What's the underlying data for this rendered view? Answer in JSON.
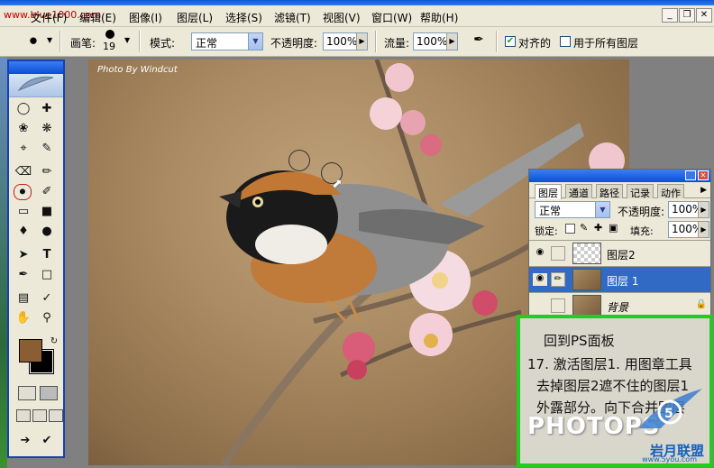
{
  "watermark_top": "www.blue1000.com",
  "menu": {
    "items": [
      "文件(F)",
      "编辑(E)",
      "图像(I)",
      "图层(L)",
      "选择(S)",
      "滤镜(T)",
      "视图(V)",
      "窗口(W)",
      "帮助(H)"
    ]
  },
  "window_controls": {
    "minimize": "_",
    "restore": "❐",
    "close": "✕"
  },
  "options": {
    "brush_label": "画笔:",
    "brush_size": "19",
    "mode_label": "模式:",
    "mode_value": "正常",
    "opacity_label": "不透明度:",
    "opacity_value": "100%",
    "flow_label": "流量:",
    "flow_value": "100%",
    "aligned_label": "对齐的",
    "aligned_checked": true,
    "all_layers_label": "用于所有图层",
    "all_layers_checked": false
  },
  "canvas": {
    "credit": "Photo By Windcut"
  },
  "layers_panel": {
    "tabs": [
      "图层",
      "通道",
      "路径",
      "记录",
      "动作"
    ],
    "active_tab": "图层",
    "blend_mode": "正常",
    "opacity_label": "不透明度:",
    "opacity_value": "100%",
    "lock_label": "锁定:",
    "fill_label": "填充:",
    "fill_value": "100%",
    "layers": [
      {
        "name": "图层2",
        "visible": true,
        "selected": false,
        "thumb": "transparent"
      },
      {
        "name": "图层 1",
        "visible": true,
        "selected": true,
        "thumb": "photo"
      },
      {
        "name": "背景",
        "visible": false,
        "selected": false,
        "thumb": "photo",
        "locked": true
      }
    ]
  },
  "annotation": {
    "lines": [
      "回到PS面板",
      "17. 激活图层1. 用图章工具",
      "去掉图层2遮不住的图层1",
      "外露部分。向下合并图层"
    ],
    "brand": "PHOTOPS",
    "logo": "岩月联盟",
    "logo_sub": "www.5you.com"
  },
  "colors": {
    "foreground": "#8b5d33",
    "background": "#000000",
    "annotation_border": "#22cc22",
    "selection": "#316ac5"
  }
}
